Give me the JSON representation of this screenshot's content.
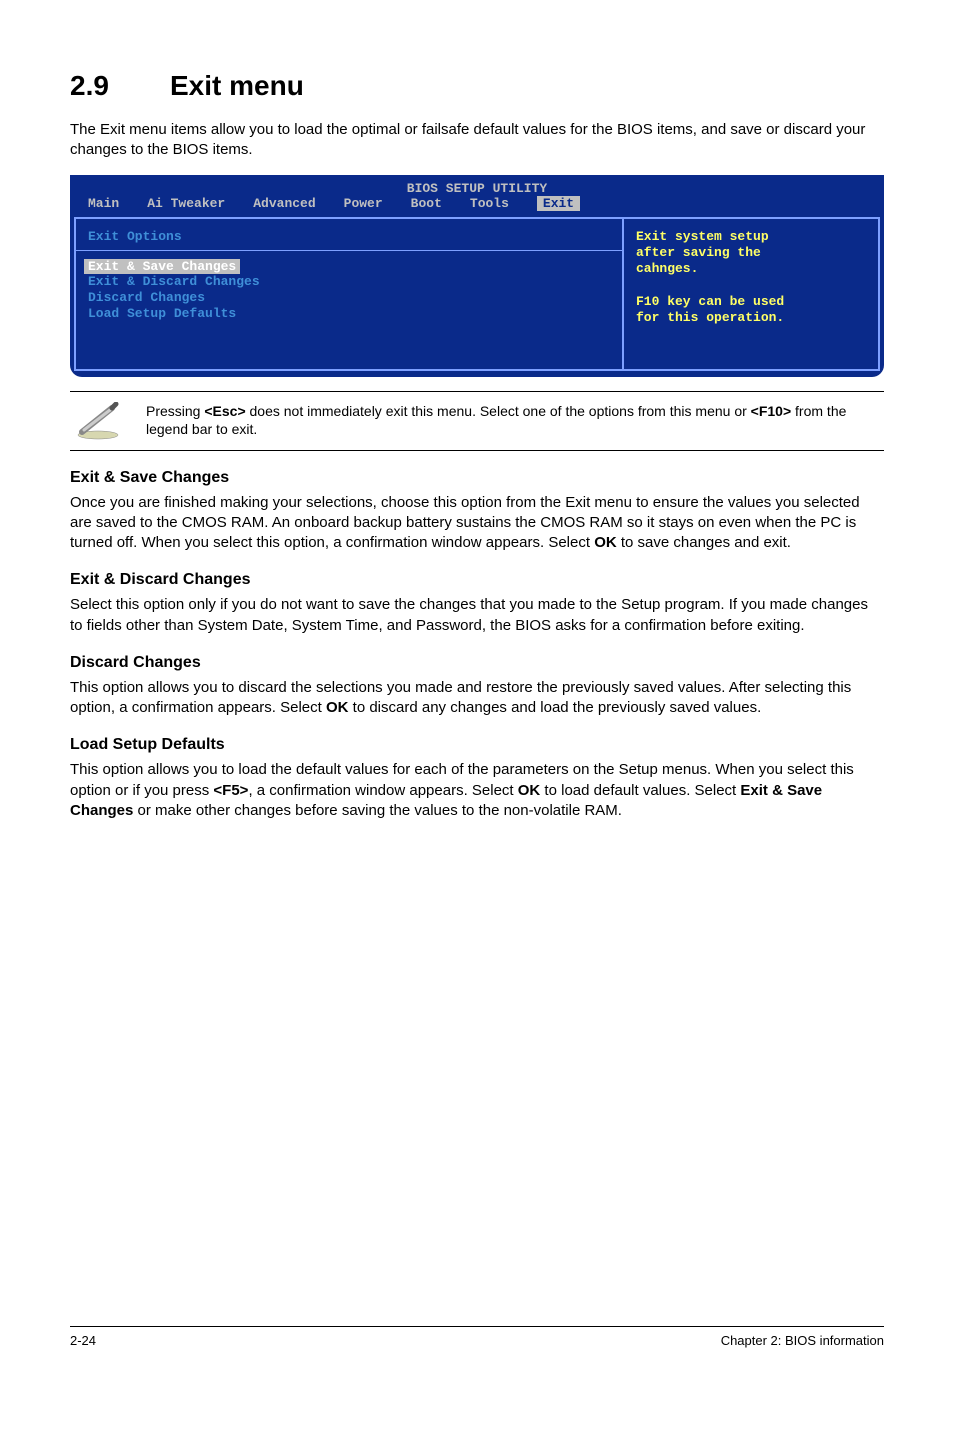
{
  "section": {
    "number": "2.9",
    "title": "Exit menu",
    "intro": "The Exit menu items allow you to load the optimal or failsafe default values for the BIOS items, and save or discard your changes to the BIOS items."
  },
  "bios": {
    "title": "BIOS SETUP UTILITY",
    "tabs": [
      "Main",
      "Ai Tweaker",
      "Advanced",
      "Power",
      "Boot",
      "Tools",
      "Exit"
    ],
    "active_tab": "Exit",
    "left": {
      "header": "Exit Options",
      "selected": "Exit & Save Changes",
      "items": [
        "Exit & Discard Changes",
        "Discard Changes",
        "",
        "Load Setup Defaults"
      ]
    },
    "right": {
      "lines": [
        "Exit system setup",
        "after saving the",
        "cahnges.",
        "",
        "F10 key can be used",
        "for this operation."
      ]
    }
  },
  "note": {
    "text_prefix": "Pressing ",
    "key1": "<Esc>",
    "text_mid": " does not immediately exit this menu. Select one of the options from this menu or ",
    "key2": "<F10>",
    "text_suffix": " from the legend bar to exit."
  },
  "subsections": [
    {
      "title": "Exit & Save Changes",
      "body_parts": [
        "Once you are finished making your selections, choose this option from the Exit menu to ensure the values you selected are saved to the CMOS RAM. An onboard backup battery sustains the CMOS RAM so it stays on even when the PC is turned off. When you select this option, a confirmation window appears. Select ",
        "OK",
        " to save changes and exit."
      ]
    },
    {
      "title": "Exit & Discard Changes",
      "body_parts": [
        "Select this option only if you do not want to save the changes that you made to the Setup program. If you made changes to fields other than System Date, System Time, and Password, the BIOS asks for a confirmation before exiting."
      ]
    },
    {
      "title": "Discard Changes",
      "body_parts": [
        "This option allows you to discard the selections you made and restore the previously saved values. After selecting this option, a confirmation appears. Select ",
        "OK",
        " to discard any changes and load the previously saved values."
      ]
    },
    {
      "title": "Load Setup Defaults",
      "body_parts": [
        "This option allows you to load the default values for each of the parameters on the Setup menus. When you select this option or if you press ",
        "<F5>",
        ", a confirmation window appears. Select ",
        "OK",
        " to load default values. Select ",
        "Exit & Save Changes",
        " or make other changes before saving the values to the non-volatile RAM."
      ]
    }
  ],
  "footer": {
    "left": "2-24",
    "right": "Chapter 2: BIOS information"
  }
}
